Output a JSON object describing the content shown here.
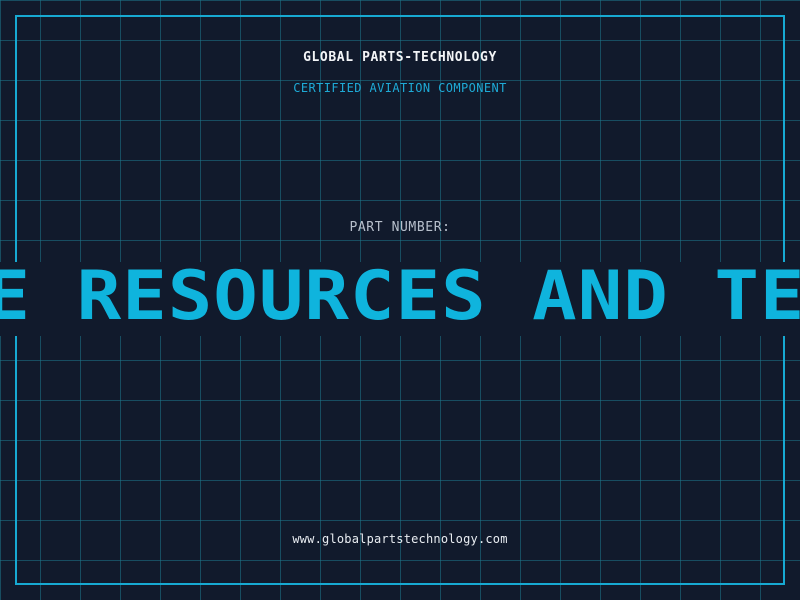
{
  "header": {
    "company_name": "GLOBAL PARTS-TECHNOLOGY",
    "subtitle": "CERTIFIED AVIATION COMPONENT"
  },
  "part": {
    "label": "PART NUMBER:",
    "value": "CE RESOURCES AND TE"
  },
  "footer": {
    "url": "www.globalpartstechnology.com"
  },
  "colors": {
    "background": "#111a2c",
    "grid_line": "#1c768c",
    "frame_border": "#17a9d2",
    "accent": "#0fb4dd",
    "title_text": "#f3f5f7",
    "label_text": "#b8c0cc"
  }
}
